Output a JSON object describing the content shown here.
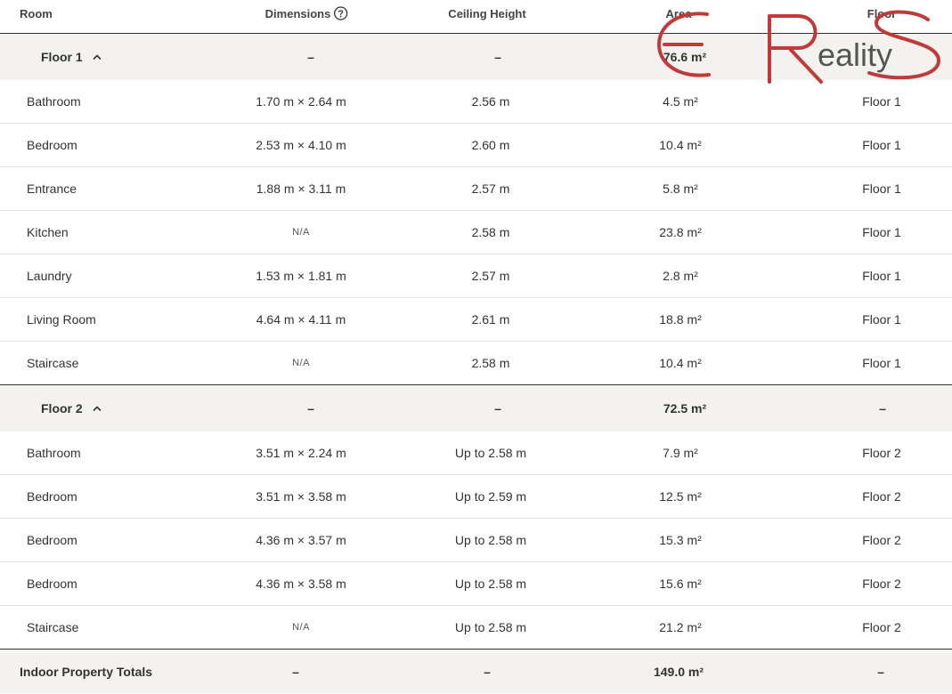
{
  "header": {
    "room": "Room",
    "dimensions": "Dimensions",
    "ceiling": "Ceiling Height",
    "area": "Area",
    "floor": "Floor"
  },
  "floors": [
    {
      "label": "Floor 1",
      "dimensions": "–",
      "ceiling": "–",
      "area": "76.6 m²",
      "floor": "",
      "rooms": [
        {
          "room": "Bathroom",
          "dimensions": "1.70 m × 2.64 m",
          "ceiling": "2.56 m",
          "area": "4.5 m²",
          "floor": "Floor 1"
        },
        {
          "room": "Bedroom",
          "dimensions": "2.53 m × 4.10 m",
          "ceiling": "2.60 m",
          "area": "10.4 m²",
          "floor": "Floor 1"
        },
        {
          "room": "Entrance",
          "dimensions": "1.88 m × 3.11 m",
          "ceiling": "2.57 m",
          "area": "5.8 m²",
          "floor": "Floor 1"
        },
        {
          "room": "Kitchen",
          "dimensions": "N/A",
          "ceiling": "2.58 m",
          "area": "23.8 m²",
          "floor": "Floor 1"
        },
        {
          "room": "Laundry",
          "dimensions": "1.53 m × 1.81 m",
          "ceiling": "2.57 m",
          "area": "2.8 m²",
          "floor": "Floor 1"
        },
        {
          "room": "Living Room",
          "dimensions": "4.64 m × 4.11 m",
          "ceiling": "2.61 m",
          "area": "18.8 m²",
          "floor": "Floor 1"
        },
        {
          "room": "Staircase",
          "dimensions": "N/A",
          "ceiling": "2.58 m",
          "area": "10.4 m²",
          "floor": "Floor 1"
        }
      ]
    },
    {
      "label": "Floor 2",
      "dimensions": "–",
      "ceiling": "–",
      "area": "72.5 m²",
      "floor": "–",
      "rooms": [
        {
          "room": "Bathroom",
          "dimensions": "3.51 m × 2.24 m",
          "ceiling": "Up to 2.58 m",
          "area": "7.9 m²",
          "floor": "Floor 2"
        },
        {
          "room": "Bedroom",
          "dimensions": "3.51 m × 3.58 m",
          "ceiling": "Up to 2.59 m",
          "area": "12.5 m²",
          "floor": "Floor 2"
        },
        {
          "room": "Bedroom",
          "dimensions": "4.36 m × 3.57 m",
          "ceiling": "Up to 2.58 m",
          "area": "15.3 m²",
          "floor": "Floor 2"
        },
        {
          "room": "Bedroom",
          "dimensions": "4.36 m × 3.58 m",
          "ceiling": "Up to 2.58 m",
          "area": "15.6 m²",
          "floor": "Floor 2"
        },
        {
          "room": "Staircase",
          "dimensions": "N/A",
          "ceiling": "Up to 2.58 m",
          "area": "21.2 m²",
          "floor": "Floor 2"
        }
      ]
    }
  ],
  "totals": {
    "label": "Indoor Property Totals",
    "dimensions": "–",
    "ceiling": "–",
    "area": "149.0 m²",
    "floor": "–"
  },
  "logo": {
    "text": "ERS Reality",
    "color": "#c0393b",
    "text_color": "#555555"
  },
  "icons": {
    "help": "help-circle-icon",
    "collapse": "chevron-up-icon"
  }
}
